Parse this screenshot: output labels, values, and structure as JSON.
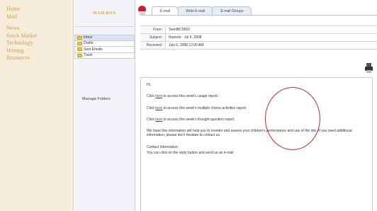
{
  "nav": {
    "items": [
      "Home",
      "Mail",
      "News",
      "Stock Market",
      "Technology",
      "Writing",
      "Resources"
    ]
  },
  "mailbox": {
    "title": "MAILBOX",
    "folders": [
      {
        "label": "Inbox",
        "active": true
      },
      {
        "label": "Drafts",
        "active": false
      },
      {
        "label": "Sent Emails",
        "active": false
      },
      {
        "label": "Trash",
        "active": false
      }
    ],
    "manage_label": "Manage Folders"
  },
  "tabs": [
    "E-mail",
    "Write E-mail",
    "E-mail Groups"
  ],
  "message": {
    "headers": [
      {
        "label": "From:",
        "value": "TeenBiC0002"
      },
      {
        "label": "Subject:",
        "value": "Reports - Jul 6, 2008"
      },
      {
        "label": "Received:",
        "value": "July 6, 2008 12:00 AM"
      }
    ],
    "greeting": "Hi,",
    "lines": [
      {
        "pre": "Click ",
        "link": "here",
        "post": " to access this week's usage report."
      },
      {
        "pre": "Click ",
        "link": "here",
        "post": " to access this week's multiple choice activities report."
      },
      {
        "pre": "Click ",
        "link": "here",
        "post": " to access this week's thought question report."
      }
    ],
    "paragraph": "We hope this information will help you to monitor and assess your children's performance and use of the site. If you need additional information, please don't hesitate to contact us.",
    "contact_heading": "Contact Information:",
    "contact_line": "You can click on the reply button and send us an e-mail"
  },
  "colors": {
    "nav_text": "#c9a25a",
    "mailbox_title": "#e5a43a",
    "link": "#2a49b8",
    "annotation": "#c82828"
  }
}
